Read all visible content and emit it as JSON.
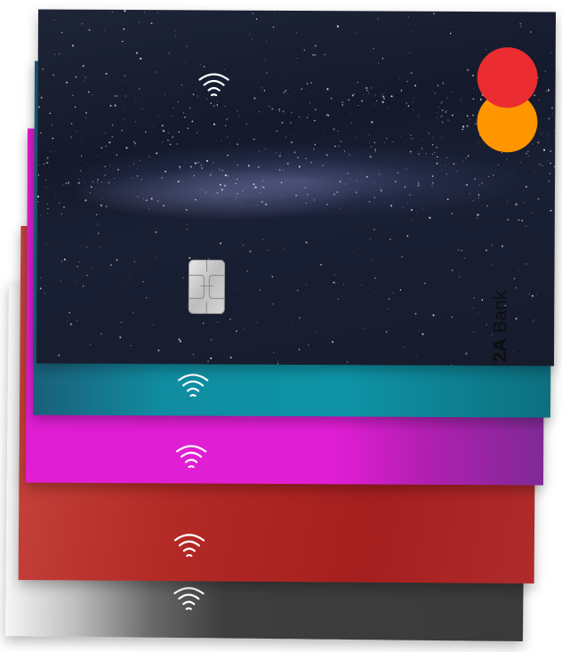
{
  "brand": {
    "bank_name_bold": "2A",
    "bank_name_rest": " Bank"
  },
  "cards": [
    {
      "name": "galaxy",
      "base_color": "#161c2c"
    },
    {
      "name": "teal",
      "base_color": "#0e94a6"
    },
    {
      "name": "magenta",
      "base_color": "#e01ed3"
    },
    {
      "name": "red",
      "base_color": "#a51f1f"
    },
    {
      "name": "grey",
      "base_color": "#3a3a3a"
    }
  ],
  "icons": {
    "contactless": "contactless-icon",
    "chip": "chip-icon",
    "network_logo": "mastercard-logo",
    "network_colors": [
      "#eb2d31",
      "#ff9600"
    ]
  }
}
